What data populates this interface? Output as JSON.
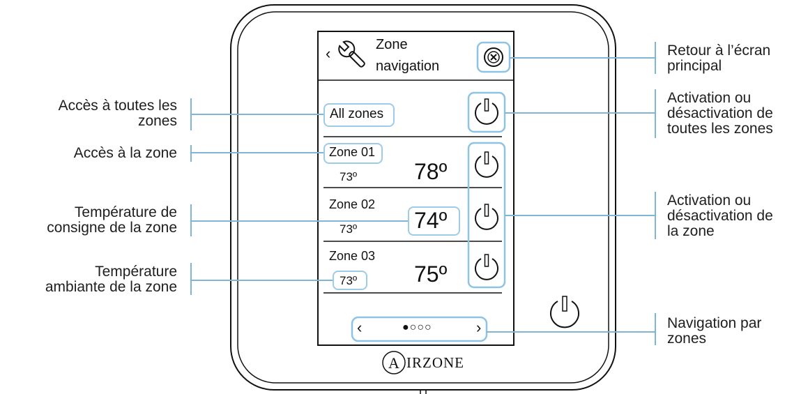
{
  "colors": {
    "accent": "#8fc3e2",
    "annotation_line": "#7fb6d6",
    "ink": "#111111",
    "text": "#1e1e1e"
  },
  "screen": {
    "title_line1": "Zone",
    "title_line2": "navigation",
    "back_glyph": "‹",
    "header_icon": "wrench-icon",
    "close_icon": "close-circle-icon",
    "all_zones_label": "All zones",
    "all_zones_power_icon": "power-icon",
    "zones": [
      {
        "name": "Zone 01",
        "ambient": "73º",
        "setpoint": "78º",
        "power_icon": "power-icon"
      },
      {
        "name": "Zone 02",
        "ambient": "73º",
        "setpoint": "74º",
        "power_icon": "power-icon"
      },
      {
        "name": "Zone 03",
        "ambient": "73º",
        "setpoint": "75º",
        "power_icon": "power-icon"
      }
    ],
    "pager": {
      "prev": "‹",
      "dots": "●○○○",
      "next": "›"
    }
  },
  "device": {
    "brand": "AIRZONE",
    "brand_rest": "IRZONE",
    "brand_initial": "A",
    "power_button_icon": "power-icon"
  },
  "annotations": {
    "left": [
      {
        "lines": [
          "Accès à toutes les",
          "zones"
        ]
      },
      {
        "lines": [
          "Accès à la zone"
        ]
      },
      {
        "lines": [
          "Température de",
          "consigne de la zone"
        ]
      },
      {
        "lines": [
          "Température",
          "ambiante de la zone"
        ]
      }
    ],
    "right": [
      {
        "lines": [
          "Retour à l’écran",
          "principal"
        ]
      },
      {
        "lines": [
          "Activation ou",
          "désactivation de",
          "toutes les zones"
        ]
      },
      {
        "lines": [
          "Activation ou",
          "désactivation de",
          "la zone"
        ]
      },
      {
        "lines": [
          "Navigation par",
          "zones"
        ]
      }
    ]
  }
}
